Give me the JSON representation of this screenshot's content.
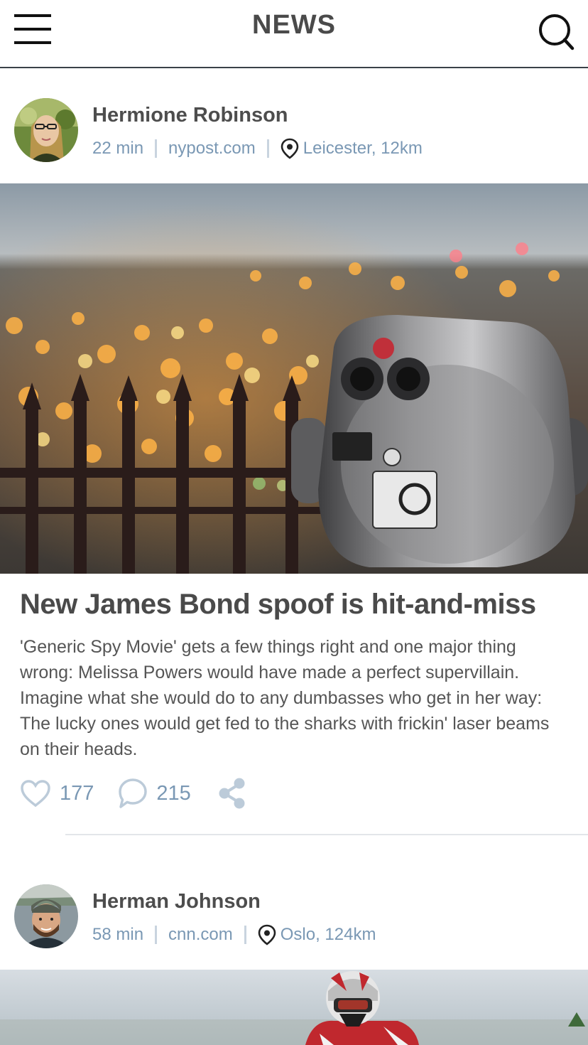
{
  "header": {
    "title": "NEWS",
    "menu_icon": "hamburger-menu-icon",
    "search_icon": "search-icon"
  },
  "posts": [
    {
      "author": "Hermione Robinson",
      "time": "22 min",
      "source": "nypost.com",
      "location": "Leicester, 12km",
      "title": "New James Bond spoof is hit-and-miss",
      "body": "'Generic Spy Movie' gets a few things right and one major thing wrong: Melissa Powers would have made a perfect supervillain. Imagine what she would do to any dumbasses who get in her way: The lucky ones would get fed to the sharks with frickin' laser beams on their heads.",
      "likes": "177",
      "comments": "215",
      "icons": [
        "heart-icon",
        "comment-icon",
        "share-icon",
        "location-pin-icon"
      ]
    },
    {
      "author": "Herman Johnson",
      "time": "58 min",
      "source": "cnn.com",
      "location": "Oslo, 124km"
    }
  ],
  "colors": {
    "accent": "#7a98b4",
    "text_dark": "#4a4a4a",
    "separator": "#c9d4df"
  }
}
